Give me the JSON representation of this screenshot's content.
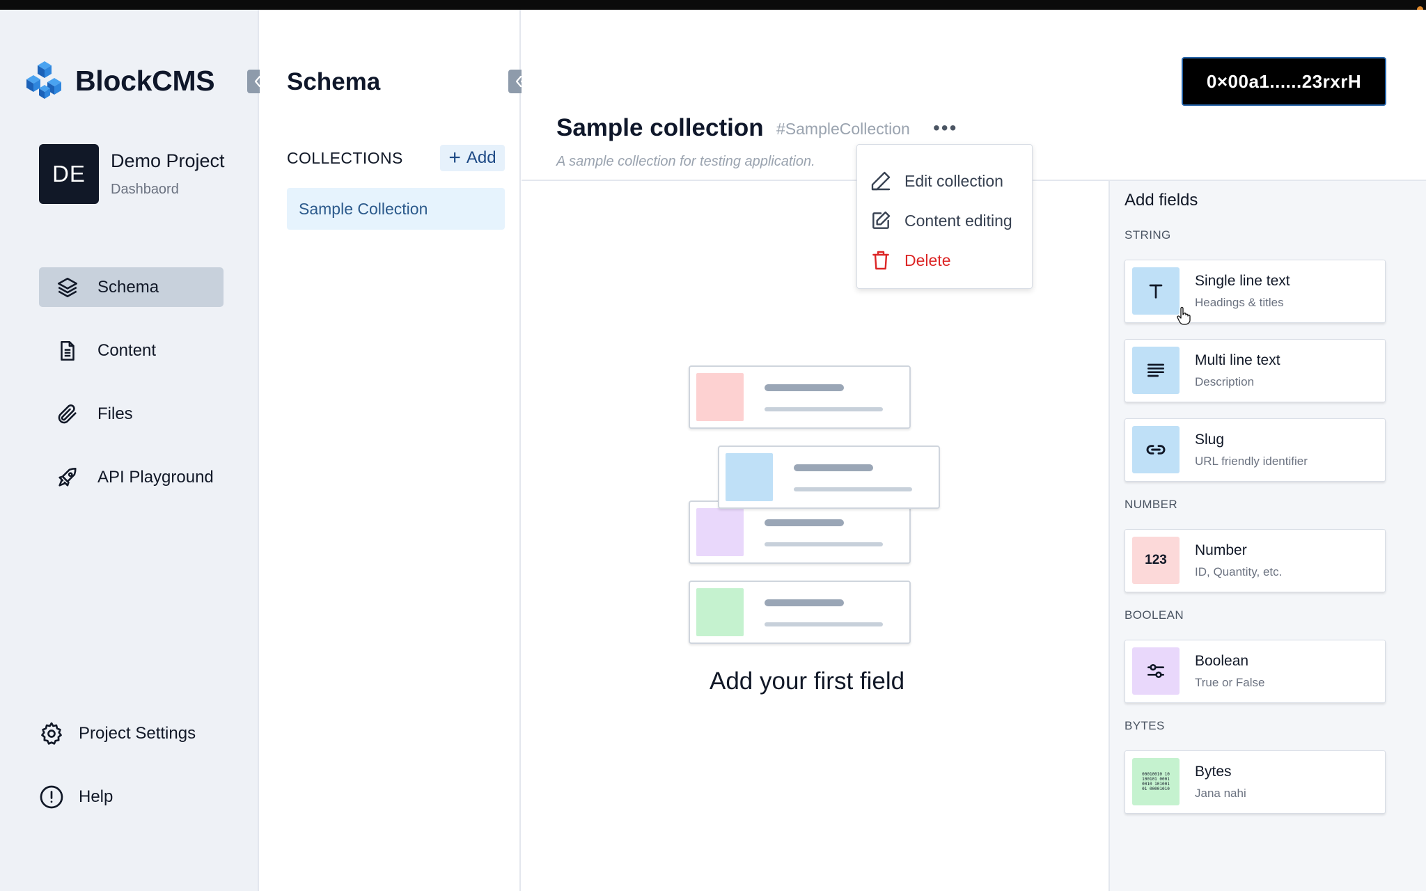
{
  "brand": {
    "name": "BlockCMS"
  },
  "project": {
    "initials": "DE",
    "name": "Demo Project",
    "subtitle": "Dashbaord"
  },
  "nav": {
    "items": [
      {
        "label": "Schema",
        "icon": "layers-icon",
        "active": true
      },
      {
        "label": "Content",
        "icon": "document-icon",
        "active": false
      },
      {
        "label": "Files",
        "icon": "paperclip-icon",
        "active": false
      },
      {
        "label": "API Playground",
        "icon": "rocket-icon",
        "active": false
      }
    ],
    "bottom": [
      {
        "label": "Project Settings",
        "icon": "gear-icon"
      },
      {
        "label": "Help",
        "icon": "alert-circle-icon"
      }
    ]
  },
  "collections_panel": {
    "title": "Schema",
    "header": "COLLECTIONS",
    "add_label": "Add",
    "items": [
      {
        "label": "Sample Collection",
        "selected": true
      }
    ]
  },
  "main": {
    "wallet": "0×00a1......23rxrH",
    "collection_title": "Sample collection",
    "collection_id": "#SampleCollection",
    "more": "•••",
    "collection_description": "A sample collection for testing application.",
    "empty_state": "Add your first field"
  },
  "menu": {
    "items": [
      {
        "label": "Edit collection",
        "icon": "pen-icon",
        "danger": false
      },
      {
        "label": "Content editing",
        "icon": "edit-square-icon",
        "danger": false
      },
      {
        "label": "Delete",
        "icon": "trash-icon",
        "danger": true
      }
    ]
  },
  "fields_panel": {
    "title": "Add fields",
    "groups": [
      {
        "label": "STRING",
        "fields": [
          {
            "name": "Single line text",
            "desc": "Headings & titles",
            "icon": "text-t-icon",
            "color": "#bfe0f7"
          },
          {
            "name": "Multi line text",
            "desc": "Description",
            "icon": "align-left-icon",
            "color": "#bfe0f7"
          },
          {
            "name": "Slug",
            "desc": "URL friendly identifier",
            "icon": "link-icon",
            "color": "#bfe0f7"
          }
        ]
      },
      {
        "label": "NUMBER",
        "fields": [
          {
            "name": "Number",
            "desc": "ID, Quantity, etc.",
            "icon": "number-123-icon",
            "color": "#fcd9d9",
            "glyph": "123"
          }
        ]
      },
      {
        "label": "BOOLEAN",
        "fields": [
          {
            "name": "Boolean",
            "desc": "True or False",
            "icon": "toggle-icon",
            "color": "#e9d8fb"
          }
        ]
      },
      {
        "label": "BYTES",
        "fields": [
          {
            "name": "Bytes",
            "desc": "Jana nahi",
            "icon": "binary-icon",
            "color": "#c5f2cf",
            "glyph": "00010010 10100101 00010010 10100101 00001010"
          }
        ]
      }
    ]
  },
  "colors": {
    "sidebar_bg": "#eef1f6",
    "active_nav": "#c8d1dc",
    "accent_blue": "#1e4a86",
    "danger": "#dc2626",
    "wallet_bg": "#000000"
  }
}
